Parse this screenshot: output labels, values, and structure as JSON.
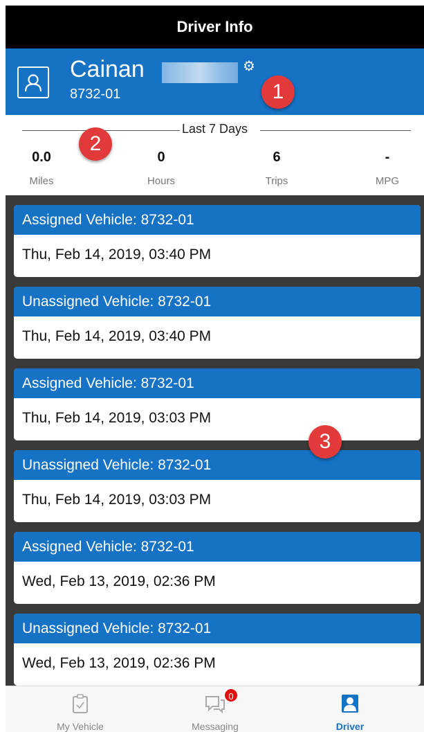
{
  "header": {
    "title": "Driver Info"
  },
  "driver": {
    "first_name": "Cainan",
    "id": "8732-01"
  },
  "callouts": {
    "one": "1",
    "two": "2",
    "three": "3"
  },
  "stats": {
    "title": "Last 7 Days",
    "items": [
      {
        "value": "0.0",
        "label": "Miles"
      },
      {
        "value": "0",
        "label": "Hours"
      },
      {
        "value": "6",
        "label": "Trips"
      },
      {
        "value": "-",
        "label": "MPG"
      }
    ]
  },
  "events": [
    {
      "title": "Assigned Vehicle: 8732-01",
      "time": "Thu, Feb 14, 2019, 03:40 PM"
    },
    {
      "title": "Unassigned Vehicle: 8732-01",
      "time": "Thu, Feb 14, 2019, 03:40 PM"
    },
    {
      "title": "Assigned Vehicle: 8732-01",
      "time": "Thu, Feb 14, 2019, 03:03 PM"
    },
    {
      "title": "Unassigned Vehicle: 8732-01",
      "time": "Thu, Feb 14, 2019, 03:03 PM"
    },
    {
      "title": "Assigned Vehicle: 8732-01",
      "time": "Wed, Feb 13, 2019, 02:36 PM"
    },
    {
      "title": "Unassigned Vehicle: 8732-01",
      "time": "Wed, Feb 13, 2019, 02:36 PM"
    }
  ],
  "tabs": [
    {
      "label": "My Vehicle",
      "icon": "clipboard-check-icon"
    },
    {
      "label": "Messaging",
      "icon": "chat-bubbles-icon",
      "badge": "0"
    },
    {
      "label": "Driver",
      "icon": "driver-profile-icon",
      "active": true
    }
  ],
  "colors": {
    "brand": "#1572c4",
    "badge": "#e23a3a",
    "background": "#3a3a3a"
  }
}
